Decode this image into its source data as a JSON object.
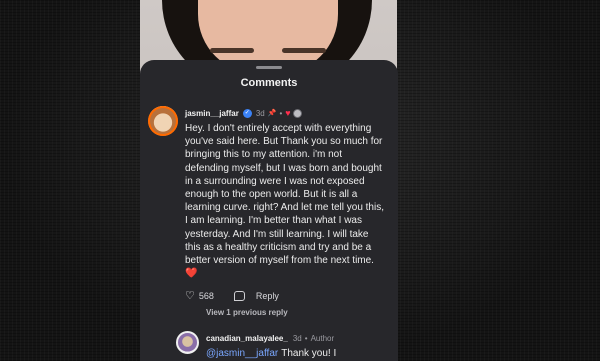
{
  "sheet": {
    "title": "Comments"
  },
  "comment": {
    "username": "jasmin__jaffar",
    "time_ago": "3d",
    "body": "Hey. I don't entirely accept with everything you've said here. But Thank you so much for bringing this to my attention. i'm not defending myself, but I was born and bought in a surrounding were I was not exposed enough to the open world. But it is all a learning curve. right? And let me tell you this, I am learning. I'm better than what I was yesterday. And I'm still learning. I will take this as a healthy criticism and try and be a better version of myself from the next time.",
    "heart_emoji": "❤️",
    "likes": "568",
    "reply_label": "Reply",
    "view_previous": "View 1 previous reply"
  },
  "reply": {
    "username": "canadian_malayalee_",
    "time_ago": "3d",
    "badge": "Author",
    "mention": "@jasmin__jaffar",
    "text": "Thank you! I"
  },
  "icons": {
    "verified": "verified-check-icon",
    "pin": "pin-icon",
    "heart": "heart-icon",
    "like": "like-heart-outline-icon",
    "reply": "reply-bubble-icon"
  },
  "colors": {
    "accent_red": "#ff2e4d",
    "mention_blue": "#7aa7ff",
    "sheet_bg": "#27272b"
  }
}
